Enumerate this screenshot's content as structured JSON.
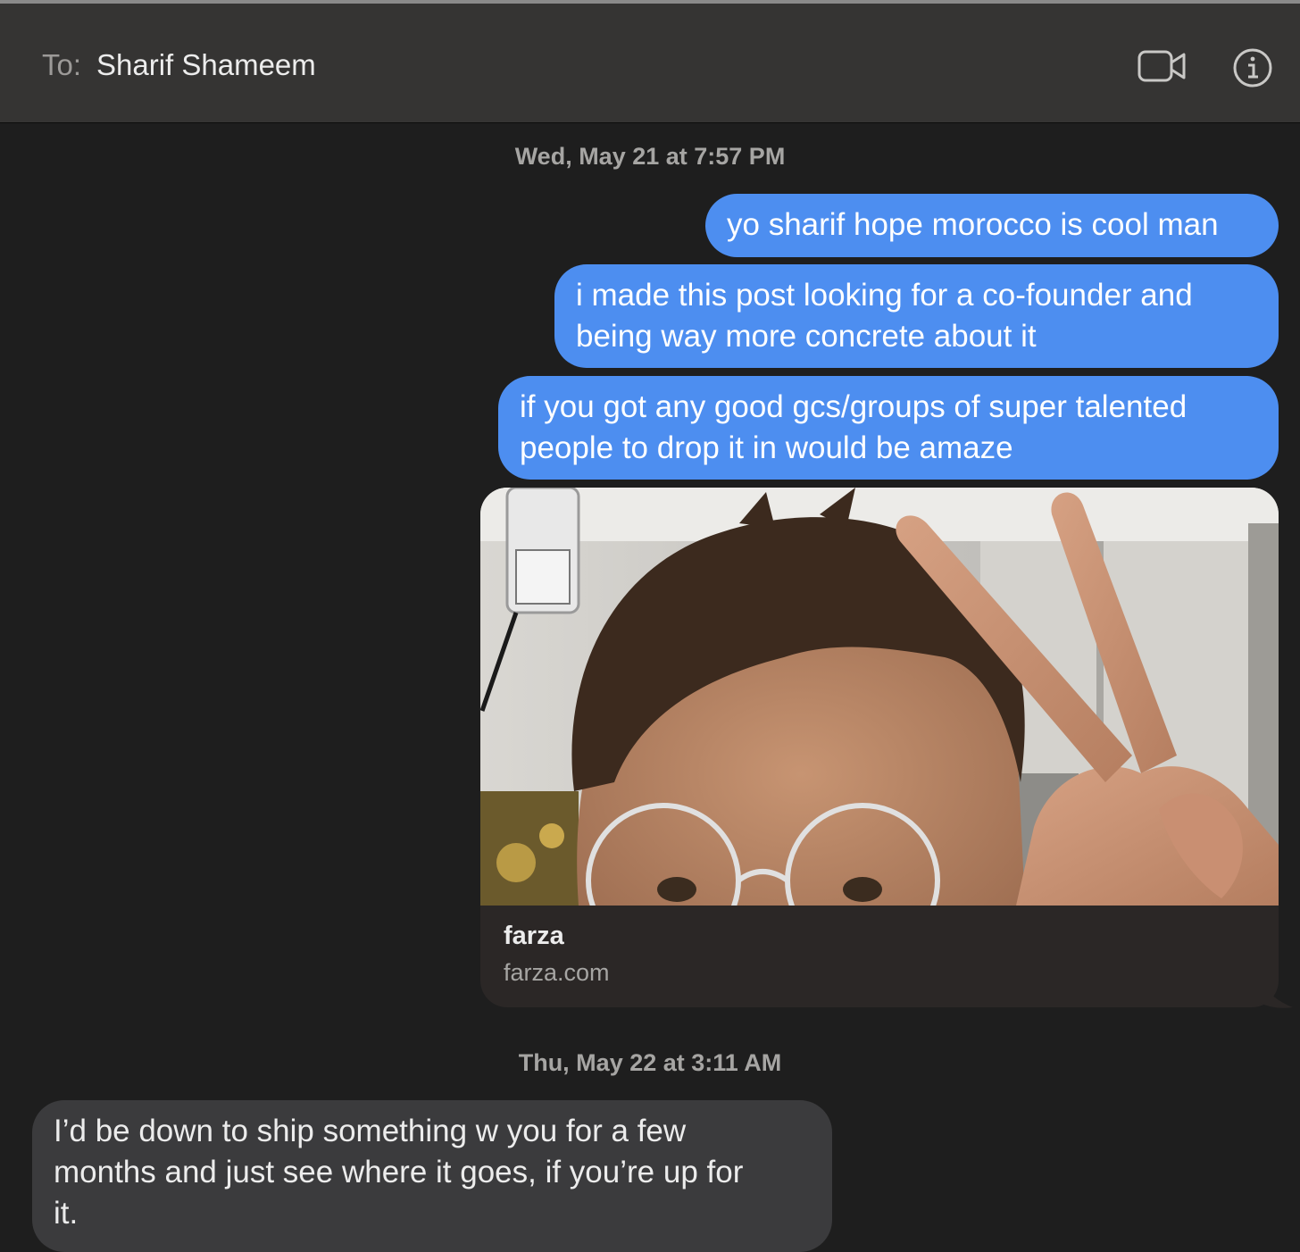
{
  "header": {
    "to_label": "To:",
    "recipient": "Sharif Shameem",
    "video_icon": "video-camera-icon",
    "info_icon": "info-icon"
  },
  "messages": {
    "timestamp_1": "Wed, May 21 at 7:57 PM",
    "sent": [
      "yo sharif hope morocco is cool man",
      "i made this post looking for a co-founder and\nbeing way more concrete about it",
      "if you got any good gcs/groups of super talented\npeople to drop it in would be amaze"
    ],
    "link_preview": {
      "title": "farza",
      "domain": "farza.com"
    },
    "timestamp_2": "Thu, May 22 at 3:11 AM",
    "received": [
      "I’d be down to ship something w you for a few\nmonths and just see where it goes, if you’re up for\nit."
    ]
  },
  "colors": {
    "sent_bubble": "#4d8ef0",
    "received_bubble": "#3b3b3d",
    "background": "#1e1e1e",
    "header": "#353433"
  }
}
